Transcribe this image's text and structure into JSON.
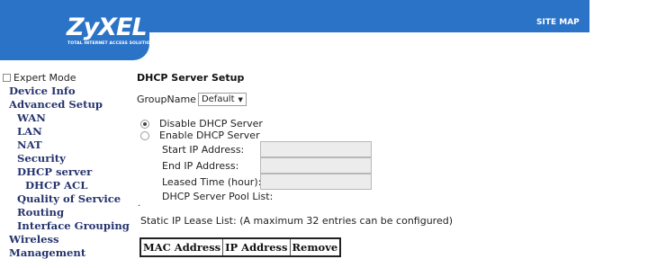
{
  "header": {
    "logo_text": "ZyXEL",
    "logo_tagline": "TOTAL INTERNET ACCESS SOLUTION",
    "sitemap_label": "SITE MAP"
  },
  "sidebar": {
    "expert_mode_label": "Expert Mode",
    "items": [
      {
        "label": "Device Info"
      },
      {
        "label": "Advanced Setup"
      },
      {
        "label": "WAN"
      },
      {
        "label": "LAN"
      },
      {
        "label": "NAT"
      },
      {
        "label": "Security"
      },
      {
        "label": "DHCP server"
      },
      {
        "label": "DHCP ACL"
      },
      {
        "label": "Quality of Service"
      },
      {
        "label": "Routing"
      },
      {
        "label": "Interface Grouping"
      },
      {
        "label": "Wireless"
      },
      {
        "label": "Management"
      }
    ]
  },
  "main": {
    "title": "DHCP Server Setup",
    "group_label": "GroupName",
    "group_value": "Default",
    "radio_disable": "Disable DHCP Server",
    "radio_enable": "Enable DHCP Server",
    "start_ip_label": "Start IP Address:",
    "end_ip_label": "End IP Address:",
    "lease_time_label": "Leased Time (hour):",
    "pool_list_label": "DHCP Server Pool List:",
    "pool_dot": ".",
    "static_lease_label": "Static IP Lease List: (A maximum 32 entries can be configured)",
    "table_headers": [
      "MAC Address",
      "IP Address",
      "Remove"
    ],
    "values": {
      "start_ip": "",
      "end_ip": "",
      "lease_time": ""
    }
  },
  "colors": {
    "brand_blue": "#2b73c7",
    "nav_text": "#26346e"
  }
}
